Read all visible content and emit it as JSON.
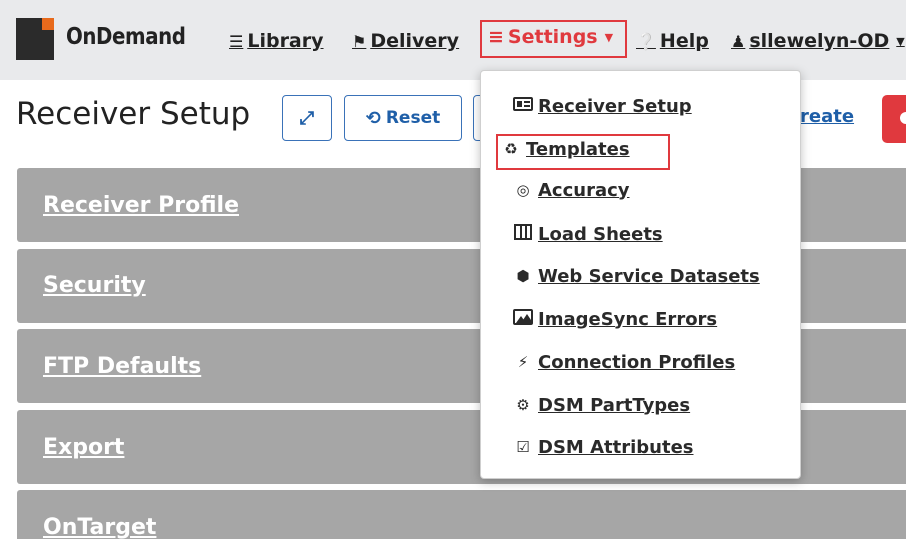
{
  "navbar": {
    "brand": "OnDemand",
    "library": {
      "label": "Library",
      "icon": "server-stack-icon"
    },
    "delivery": {
      "label": "Delivery",
      "icon": "flag-checkered-icon"
    },
    "settings": {
      "label": "Settings",
      "icon": "sliders-icon"
    },
    "help": {
      "label": "Help",
      "icon": "question-circle-icon"
    },
    "user": {
      "label": "sllewelyn-OD",
      "icon": "user-icon"
    }
  },
  "header": {
    "title": "Receiver Setup",
    "reset_label": "Reset",
    "create_label": "reate"
  },
  "panels": [
    "Receiver Profile",
    "Security",
    "FTP Defaults",
    "Export",
    "OnTarget"
  ],
  "settings_menu": [
    {
      "label": "Receiver Setup",
      "icon": "id-card-icon"
    },
    {
      "label": "Templates",
      "icon": "sitemap-icon"
    },
    {
      "label": "Accuracy",
      "icon": "bullseye-icon"
    },
    {
      "label": "Load Sheets",
      "icon": "columns-icon"
    },
    {
      "label": "Web Service Datasets",
      "icon": "cube-icon"
    },
    {
      "label": "ImageSync Errors",
      "icon": "image-icon"
    },
    {
      "label": "Connection Profiles",
      "icon": "plug-icon"
    },
    {
      "label": "DSM PartTypes",
      "icon": "cog-icon"
    },
    {
      "label": "DSM Attributes",
      "icon": "check-square-icon"
    }
  ],
  "colors": {
    "navbar_bg": "#e9eaec",
    "highlight": "#e0393e",
    "primary": "#1f5fa8",
    "panel_bg": "#a6a6a6",
    "logo_accent": "#e86a1c"
  }
}
